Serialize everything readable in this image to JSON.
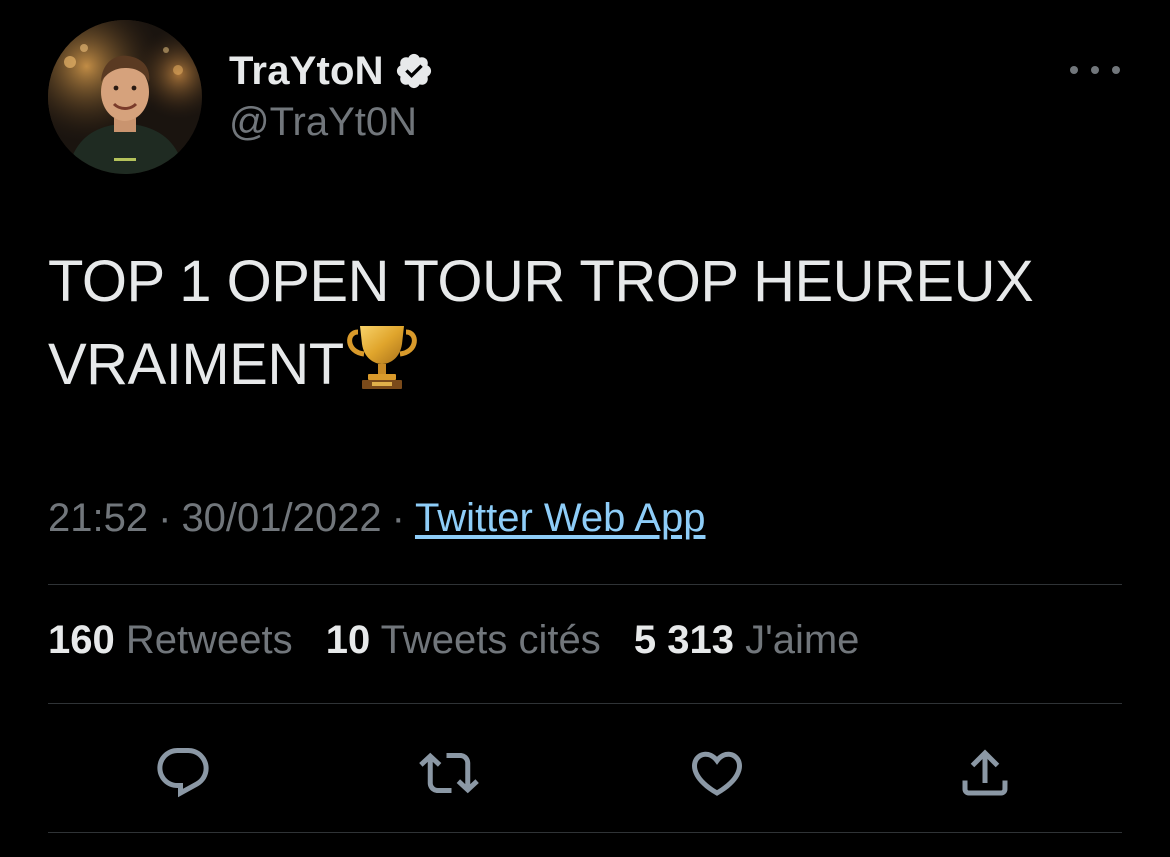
{
  "author": {
    "display_name": "TraYtoN",
    "handle": "@TraYt0N",
    "verified_icon": "verified-badge-icon",
    "avatar_icon": "avatar-photo"
  },
  "tweet": {
    "text": "TOP 1 OPEN TOUR TROP HEUREUX VRAIMENT",
    "emoji": "trophy-emoji"
  },
  "meta": {
    "time": "21:52",
    "separator": "·",
    "date": "30/01/2022",
    "source": "Twitter Web App"
  },
  "stats": {
    "retweets_count": "160",
    "retweets_label": "Retweets",
    "quotes_count": "10",
    "quotes_label": "Tweets cités",
    "likes_count": "5 313",
    "likes_label": "J'aime"
  },
  "actions": {
    "reply_icon": "reply-icon",
    "retweet_icon": "retweet-icon",
    "like_icon": "heart-icon",
    "share_icon": "share-icon",
    "more_icon": "more-options-icon"
  },
  "colors": {
    "background": "#000000",
    "primary_text": "#e7e9ea",
    "secondary_text": "#71767b",
    "link": "#8ecdf8",
    "divider": "#2f3336"
  }
}
